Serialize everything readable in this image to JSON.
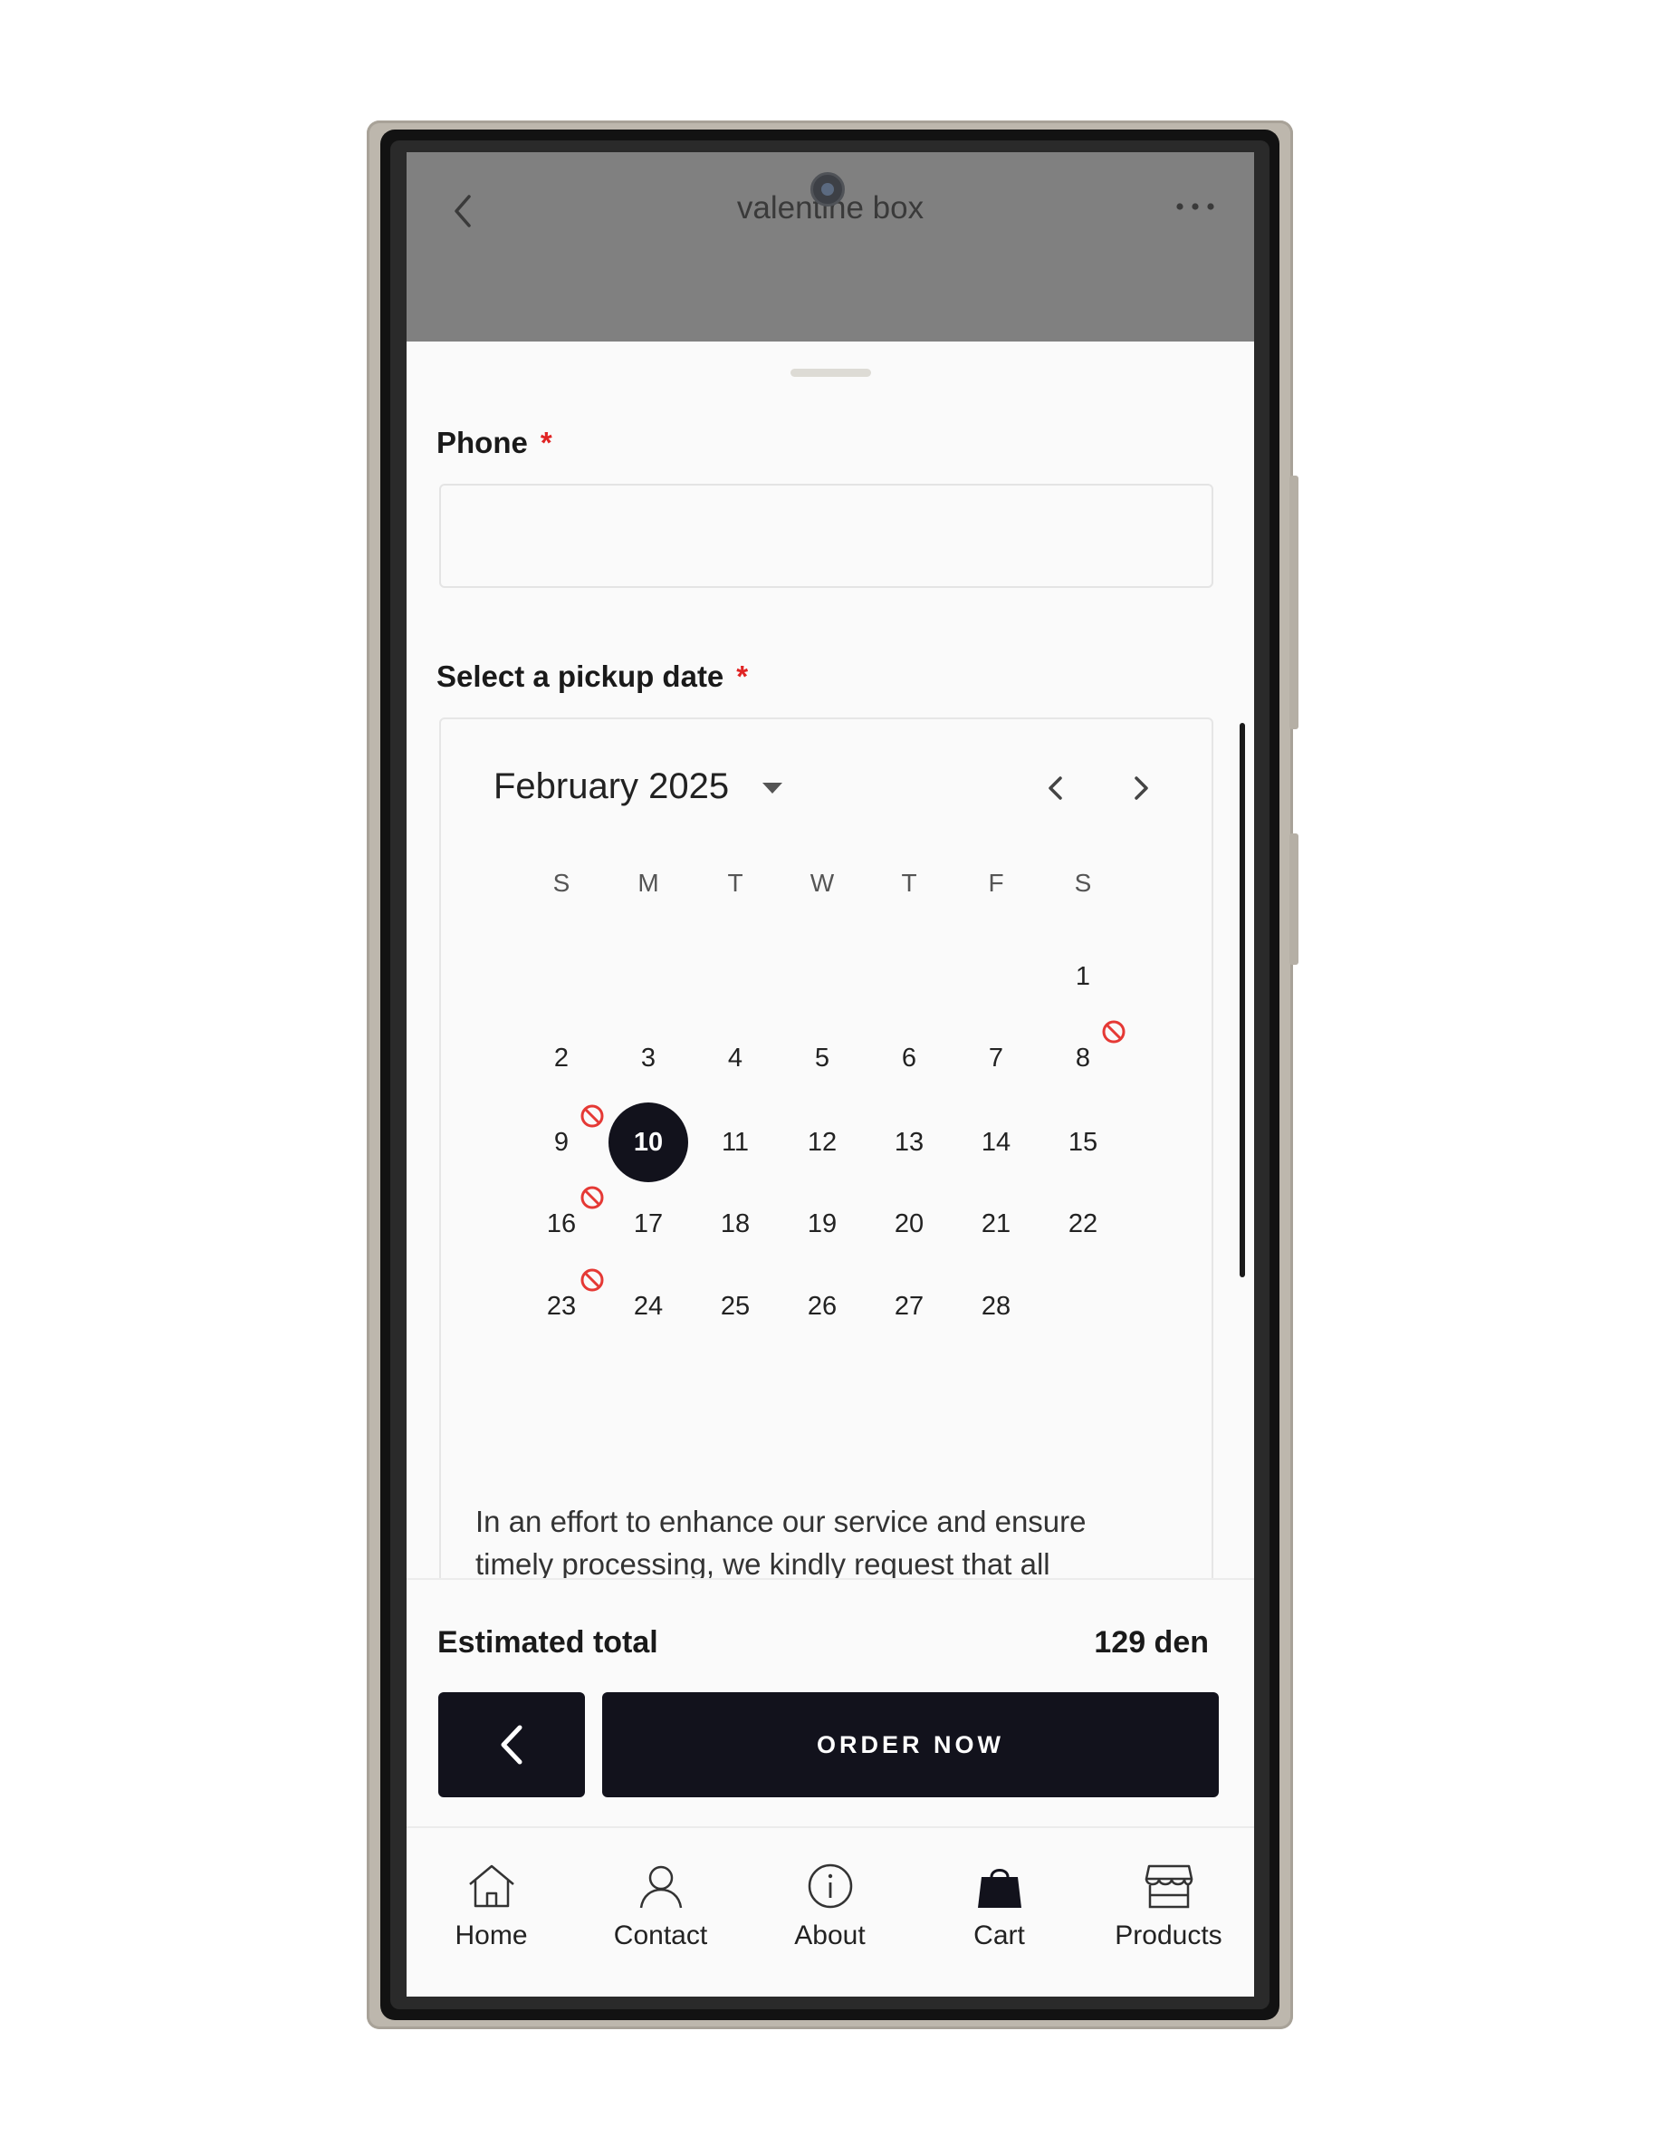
{
  "header": {
    "title": "valentine box"
  },
  "form": {
    "phone_label": "Phone",
    "phone_required": "*",
    "phone_value": "",
    "date_label": "Select a pickup date",
    "date_required": "*"
  },
  "calendar": {
    "month_label": "February 2025",
    "weekdays": [
      "S",
      "M",
      "T",
      "W",
      "T",
      "F",
      "S"
    ],
    "selected_day": "10",
    "unavailable_days": [
      "8",
      "9",
      "16",
      "23"
    ],
    "days": [
      "1",
      "2",
      "3",
      "4",
      "5",
      "6",
      "7",
      "8",
      "9",
      "10",
      "11",
      "12",
      "13",
      "14",
      "15",
      "16",
      "17",
      "18",
      "19",
      "20",
      "21",
      "22",
      "23",
      "24",
      "25",
      "26",
      "27",
      "28"
    ]
  },
  "note": {
    "text": "In an effort to enhance our service and ensure timely processing, we kindly request that all"
  },
  "summary": {
    "label": "Estimated total",
    "value": "129 den"
  },
  "actions": {
    "order_label": "ORDER NOW"
  },
  "bottom_nav": [
    {
      "label": "Home",
      "icon": "home-icon"
    },
    {
      "label": "Contact",
      "icon": "user-icon"
    },
    {
      "label": "About",
      "icon": "info-icon"
    },
    {
      "label": "Cart",
      "icon": "shopping-bag-icon"
    },
    {
      "label": "Products",
      "icon": "store-icon"
    }
  ],
  "colors": {
    "primary": "#12121c",
    "required": "#e02424",
    "blocked": "#e53935",
    "overlay": "#808080"
  }
}
